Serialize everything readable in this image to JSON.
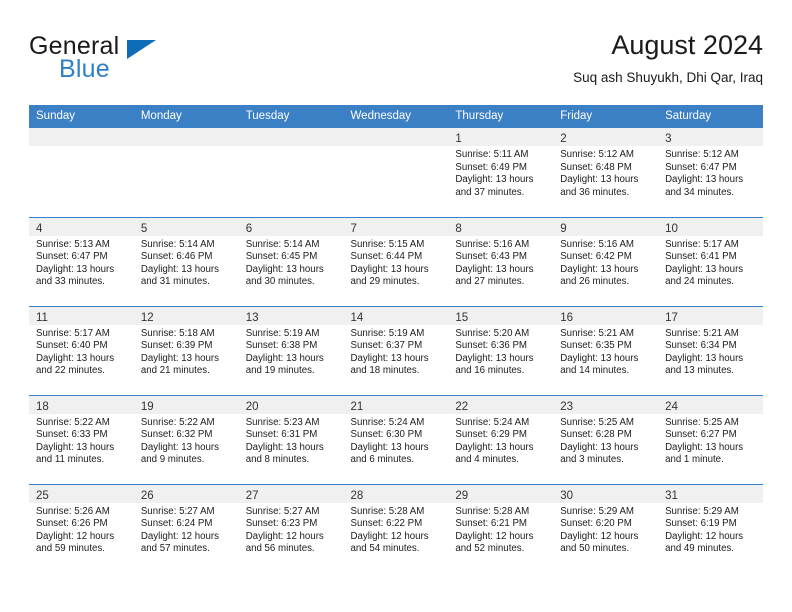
{
  "brand": {
    "name_top": "General",
    "name_bottom": "Blue",
    "triangle_color": "#0f6cb6",
    "blue_text_color": "#2f7fc4",
    "logo_icon": "triangle-logo-icon"
  },
  "header": {
    "month_title": "August 2024",
    "location": "Suq ash Shuyukh, Dhi Qar, Iraq"
  },
  "theme": {
    "header_bg": "#3b7fc4",
    "header_text": "#ffffff",
    "daynum_strip_bg": "#f0f0f0",
    "row_divider": "#3b7fc4",
    "body_text": "#202020"
  },
  "weekday_headers": [
    "Sunday",
    "Monday",
    "Tuesday",
    "Wednesday",
    "Thursday",
    "Friday",
    "Saturday"
  ],
  "weeks": [
    [
      {
        "day": "",
        "lines": []
      },
      {
        "day": "",
        "lines": []
      },
      {
        "day": "",
        "lines": []
      },
      {
        "day": "",
        "lines": []
      },
      {
        "day": "1",
        "lines": [
          "Sunrise: 5:11 AM",
          "Sunset: 6:49 PM",
          "Daylight: 13 hours",
          "and 37 minutes."
        ]
      },
      {
        "day": "2",
        "lines": [
          "Sunrise: 5:12 AM",
          "Sunset: 6:48 PM",
          "Daylight: 13 hours",
          "and 36 minutes."
        ]
      },
      {
        "day": "3",
        "lines": [
          "Sunrise: 5:12 AM",
          "Sunset: 6:47 PM",
          "Daylight: 13 hours",
          "and 34 minutes."
        ]
      }
    ],
    [
      {
        "day": "4",
        "lines": [
          "Sunrise: 5:13 AM",
          "Sunset: 6:47 PM",
          "Daylight: 13 hours",
          "and 33 minutes."
        ]
      },
      {
        "day": "5",
        "lines": [
          "Sunrise: 5:14 AM",
          "Sunset: 6:46 PM",
          "Daylight: 13 hours",
          "and 31 minutes."
        ]
      },
      {
        "day": "6",
        "lines": [
          "Sunrise: 5:14 AM",
          "Sunset: 6:45 PM",
          "Daylight: 13 hours",
          "and 30 minutes."
        ]
      },
      {
        "day": "7",
        "lines": [
          "Sunrise: 5:15 AM",
          "Sunset: 6:44 PM",
          "Daylight: 13 hours",
          "and 29 minutes."
        ]
      },
      {
        "day": "8",
        "lines": [
          "Sunrise: 5:16 AM",
          "Sunset: 6:43 PM",
          "Daylight: 13 hours",
          "and 27 minutes."
        ]
      },
      {
        "day": "9",
        "lines": [
          "Sunrise: 5:16 AM",
          "Sunset: 6:42 PM",
          "Daylight: 13 hours",
          "and 26 minutes."
        ]
      },
      {
        "day": "10",
        "lines": [
          "Sunrise: 5:17 AM",
          "Sunset: 6:41 PM",
          "Daylight: 13 hours",
          "and 24 minutes."
        ]
      }
    ],
    [
      {
        "day": "11",
        "lines": [
          "Sunrise: 5:17 AM",
          "Sunset: 6:40 PM",
          "Daylight: 13 hours",
          "and 22 minutes."
        ]
      },
      {
        "day": "12",
        "lines": [
          "Sunrise: 5:18 AM",
          "Sunset: 6:39 PM",
          "Daylight: 13 hours",
          "and 21 minutes."
        ]
      },
      {
        "day": "13",
        "lines": [
          "Sunrise: 5:19 AM",
          "Sunset: 6:38 PM",
          "Daylight: 13 hours",
          "and 19 minutes."
        ]
      },
      {
        "day": "14",
        "lines": [
          "Sunrise: 5:19 AM",
          "Sunset: 6:37 PM",
          "Daylight: 13 hours",
          "and 18 minutes."
        ]
      },
      {
        "day": "15",
        "lines": [
          "Sunrise: 5:20 AM",
          "Sunset: 6:36 PM",
          "Daylight: 13 hours",
          "and 16 minutes."
        ]
      },
      {
        "day": "16",
        "lines": [
          "Sunrise: 5:21 AM",
          "Sunset: 6:35 PM",
          "Daylight: 13 hours",
          "and 14 minutes."
        ]
      },
      {
        "day": "17",
        "lines": [
          "Sunrise: 5:21 AM",
          "Sunset: 6:34 PM",
          "Daylight: 13 hours",
          "and 13 minutes."
        ]
      }
    ],
    [
      {
        "day": "18",
        "lines": [
          "Sunrise: 5:22 AM",
          "Sunset: 6:33 PM",
          "Daylight: 13 hours",
          "and 11 minutes."
        ]
      },
      {
        "day": "19",
        "lines": [
          "Sunrise: 5:22 AM",
          "Sunset: 6:32 PM",
          "Daylight: 13 hours",
          "and 9 minutes."
        ]
      },
      {
        "day": "20",
        "lines": [
          "Sunrise: 5:23 AM",
          "Sunset: 6:31 PM",
          "Daylight: 13 hours",
          "and 8 minutes."
        ]
      },
      {
        "day": "21",
        "lines": [
          "Sunrise: 5:24 AM",
          "Sunset: 6:30 PM",
          "Daylight: 13 hours",
          "and 6 minutes."
        ]
      },
      {
        "day": "22",
        "lines": [
          "Sunrise: 5:24 AM",
          "Sunset: 6:29 PM",
          "Daylight: 13 hours",
          "and 4 minutes."
        ]
      },
      {
        "day": "23",
        "lines": [
          "Sunrise: 5:25 AM",
          "Sunset: 6:28 PM",
          "Daylight: 13 hours",
          "and 3 minutes."
        ]
      },
      {
        "day": "24",
        "lines": [
          "Sunrise: 5:25 AM",
          "Sunset: 6:27 PM",
          "Daylight: 13 hours",
          "and 1 minute."
        ]
      }
    ],
    [
      {
        "day": "25",
        "lines": [
          "Sunrise: 5:26 AM",
          "Sunset: 6:26 PM",
          "Daylight: 12 hours",
          "and 59 minutes."
        ]
      },
      {
        "day": "26",
        "lines": [
          "Sunrise: 5:27 AM",
          "Sunset: 6:24 PM",
          "Daylight: 12 hours",
          "and 57 minutes."
        ]
      },
      {
        "day": "27",
        "lines": [
          "Sunrise: 5:27 AM",
          "Sunset: 6:23 PM",
          "Daylight: 12 hours",
          "and 56 minutes."
        ]
      },
      {
        "day": "28",
        "lines": [
          "Sunrise: 5:28 AM",
          "Sunset: 6:22 PM",
          "Daylight: 12 hours",
          "and 54 minutes."
        ]
      },
      {
        "day": "29",
        "lines": [
          "Sunrise: 5:28 AM",
          "Sunset: 6:21 PM",
          "Daylight: 12 hours",
          "and 52 minutes."
        ]
      },
      {
        "day": "30",
        "lines": [
          "Sunrise: 5:29 AM",
          "Sunset: 6:20 PM",
          "Daylight: 12 hours",
          "and 50 minutes."
        ]
      },
      {
        "day": "31",
        "lines": [
          "Sunrise: 5:29 AM",
          "Sunset: 6:19 PM",
          "Daylight: 12 hours",
          "and 49 minutes."
        ]
      }
    ]
  ]
}
